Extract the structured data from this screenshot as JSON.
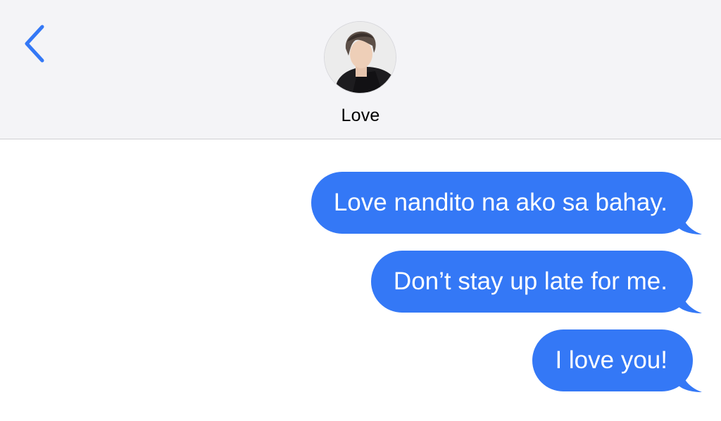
{
  "header": {
    "back_icon": "chevron-left-icon",
    "contact_name": "Love",
    "accent_color": "#3478f6"
  },
  "messages": [
    {
      "direction": "outgoing",
      "text": "Love nandito na ako sa bahay."
    },
    {
      "direction": "outgoing",
      "text": "Don’t stay up late for me."
    },
    {
      "direction": "outgoing",
      "text": "I love you!"
    }
  ]
}
